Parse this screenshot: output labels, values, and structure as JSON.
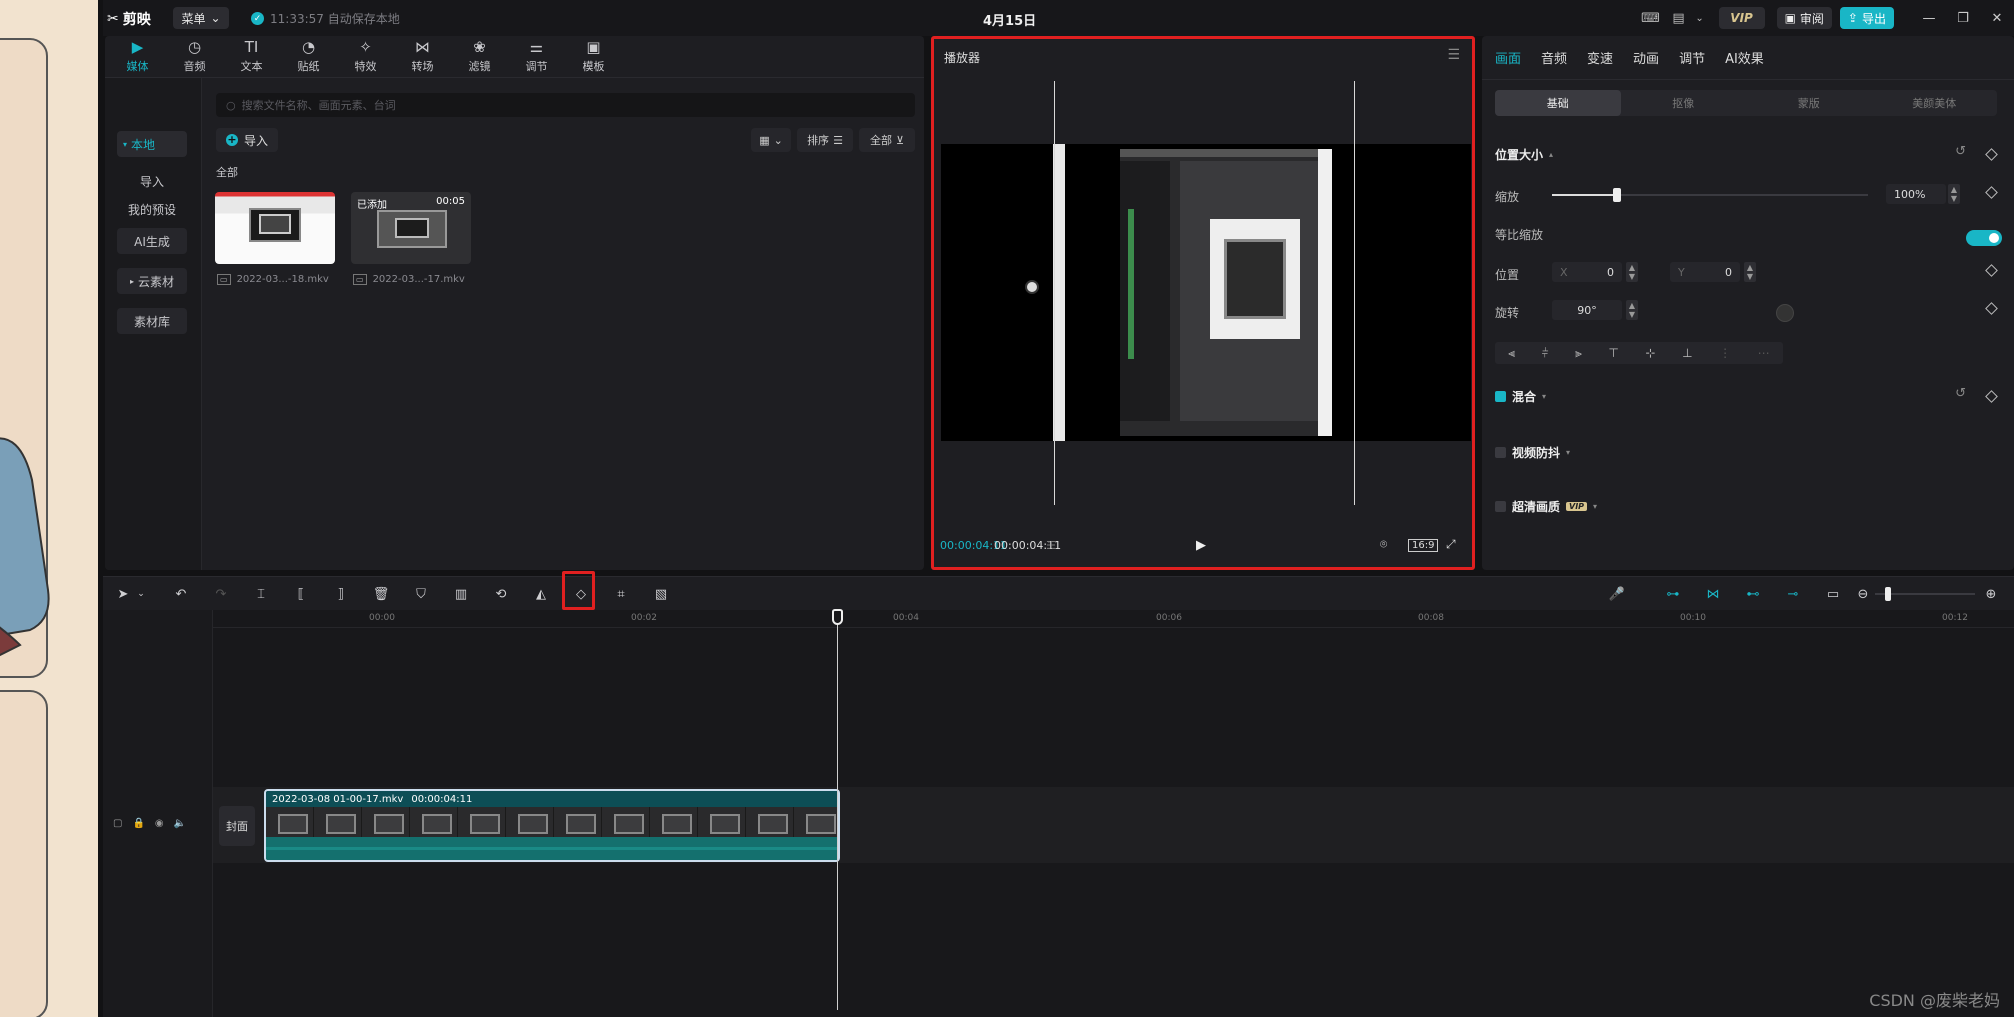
{
  "topbar": {
    "logo": "剪映",
    "menu": "菜单",
    "autosave": "11:33:57 自动保存本地",
    "title": "4月15日",
    "vip": "VIP",
    "review": "审阅",
    "export": "导出"
  },
  "media_tabs": [
    {
      "label": "媒体",
      "icon": "media-icon"
    },
    {
      "label": "音频",
      "icon": "audio-icon"
    },
    {
      "label": "文本",
      "icon": "text-icon",
      "glyph": "TI"
    },
    {
      "label": "贴纸",
      "icon": "sticker-icon"
    },
    {
      "label": "特效",
      "icon": "effects-icon"
    },
    {
      "label": "转场",
      "icon": "transition-icon"
    },
    {
      "label": "滤镜",
      "icon": "filter-icon"
    },
    {
      "label": "调节",
      "icon": "adjust-icon"
    },
    {
      "label": "模板",
      "icon": "template-icon"
    }
  ],
  "media_side": [
    "本地",
    "导入",
    "我的预设",
    "AI生成",
    "云素材",
    "素材库"
  ],
  "media": {
    "search_placeholder": "搜索文件名称、画面元素、台词",
    "import": "导入",
    "sort": "排序",
    "filter": "全部",
    "all_label": "全部",
    "clips": [
      {
        "name": "2022-03...-18.mkv"
      },
      {
        "name": "2022-03...-17.mkv",
        "added": "已添加",
        "duration": "00:05"
      }
    ]
  },
  "player": {
    "title": "播放器",
    "current": "00:00:04:11",
    "total": "00:00:04:11",
    "ratio": "16:9"
  },
  "props": {
    "tabs": [
      "画面",
      "音频",
      "变速",
      "动画",
      "调节",
      "AI效果"
    ],
    "subtabs": [
      "基础",
      "抠像",
      "蒙版",
      "美颜美体"
    ],
    "section_position": "位置大小",
    "scale_label": "缩放",
    "scale_value": "100%",
    "uniform_scale": "等比缩放",
    "position_label": "位置",
    "pos_x_label": "X",
    "pos_x": "0",
    "pos_y_label": "Y",
    "pos_y": "0",
    "rotate_label": "旋转",
    "rotate_value": "90°",
    "blend": "混合",
    "stabilize": "视频防抖",
    "hd": "超清画质",
    "vip_tag": "VIP"
  },
  "timeline": {
    "ticks": [
      "00:00",
      "00:02",
      "00:04",
      "00:06",
      "00:08",
      "00:10",
      "00:12"
    ],
    "cover": "封面",
    "clip_name": "2022-03-08 01-00-17.mkv",
    "clip_duration": "00:00:04:11"
  },
  "watermark": "CSDN @废柴老妈"
}
